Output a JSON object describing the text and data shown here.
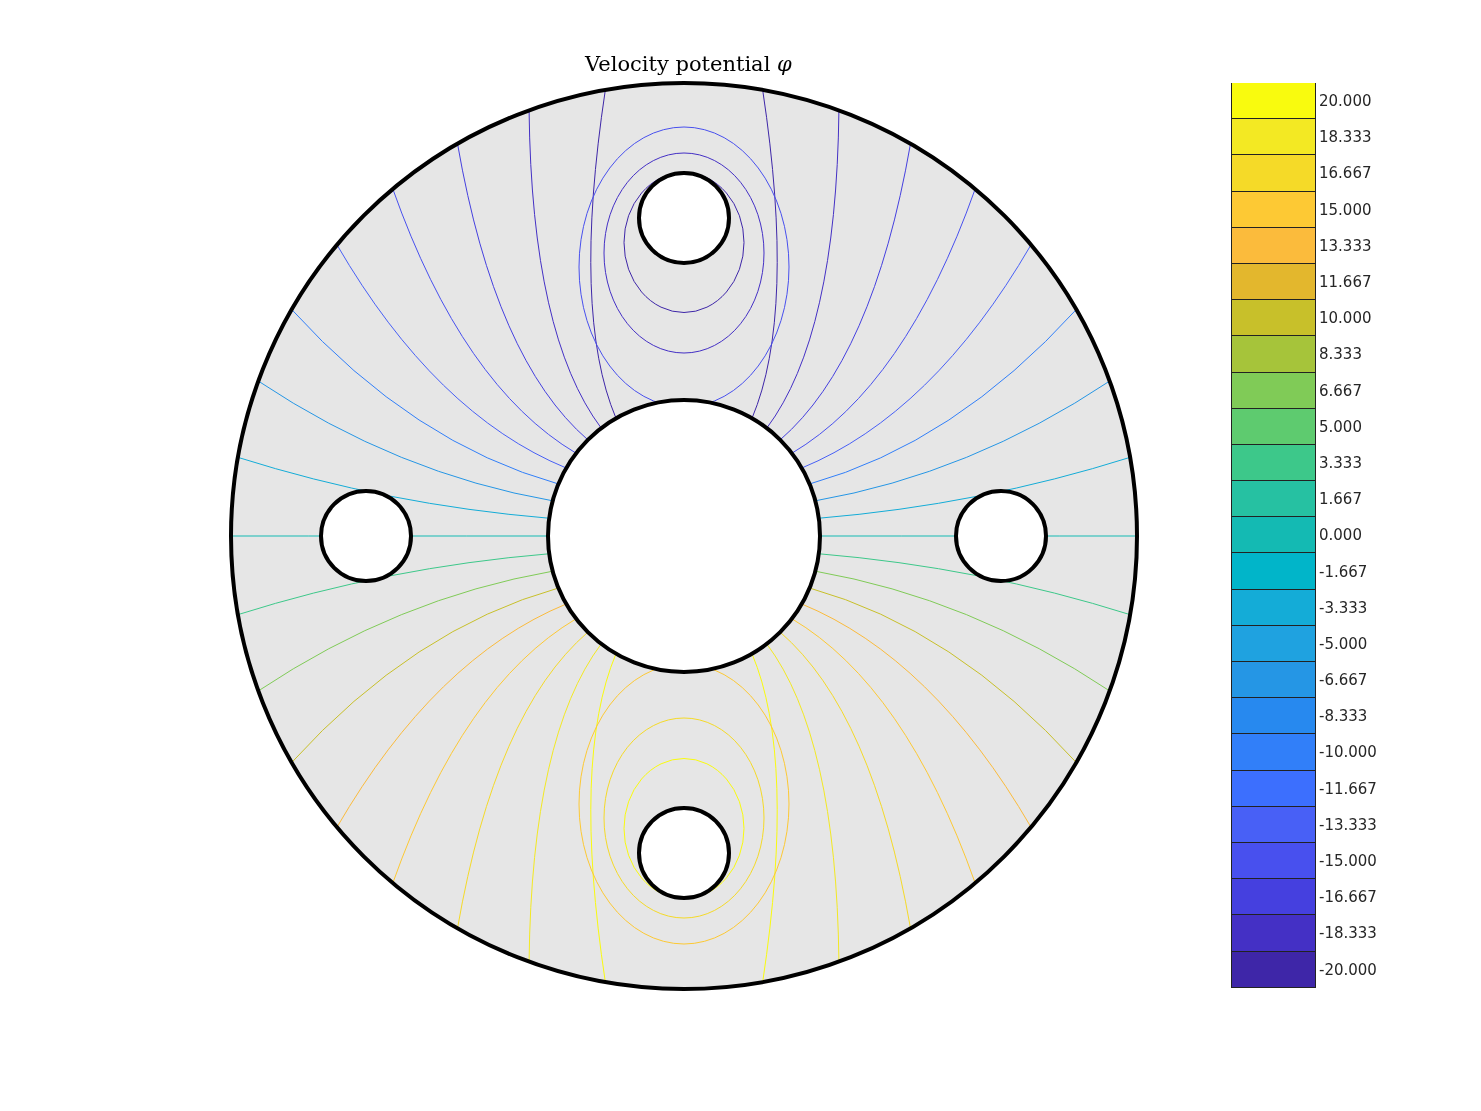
{
  "title": "Velocity potential *φ*",
  "colorbar": [
    {
      "label": "20.000",
      "color": "#f9fb0e"
    },
    {
      "label": "18.333",
      "color": "#f3e923"
    },
    {
      "label": "16.667",
      "color": "#f5da28"
    },
    {
      "label": "15.000",
      "color": "#fdc934"
    },
    {
      "label": "13.333",
      "color": "#fbbb3c"
    },
    {
      "label": "11.667",
      "color": "#e3b72d"
    },
    {
      "label": "10.000",
      "color": "#c8c02a"
    },
    {
      "label": "8.333",
      "color": "#a6c43a"
    },
    {
      "label": "6.667",
      "color": "#80cb57"
    },
    {
      "label": "5.000",
      "color": "#5ecb6f"
    },
    {
      "label": "3.333",
      "color": "#3dc88a"
    },
    {
      "label": "1.667",
      "color": "#26c1a2"
    },
    {
      "label": "0.000",
      "color": "#14bab3"
    },
    {
      "label": "-1.667",
      "color": "#01b5c9"
    },
    {
      "label": "-3.333",
      "color": "#14acd7"
    },
    {
      "label": "-5.000",
      "color": "#1fa2e0"
    },
    {
      "label": "-6.667",
      "color": "#2596e5"
    },
    {
      "label": "-8.333",
      "color": "#2789ef"
    },
    {
      "label": "-10.000",
      "color": "#317ff9"
    },
    {
      "label": "-11.667",
      "color": "#3c6ffe"
    },
    {
      "label": "-13.333",
      "color": "#4860f6"
    },
    {
      "label": "-15.000",
      "color": "#4850ee"
    },
    {
      "label": "-16.667",
      "color": "#4540df"
    },
    {
      "label": "-18.333",
      "color": "#4430c5"
    },
    {
      "label": "-20.000",
      "color": "#3e26a8"
    }
  ]
}
